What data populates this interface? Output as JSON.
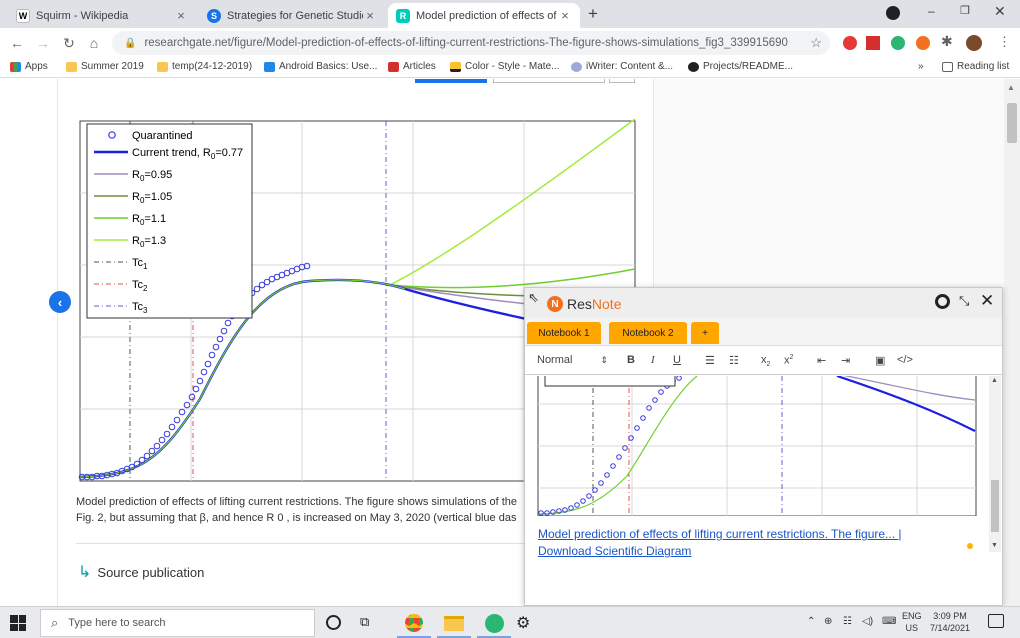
{
  "tabs": [
    {
      "title": "Squirm - Wikipedia",
      "favicon": "W"
    },
    {
      "title": "Strategies for Genetic Studies of",
      "favicon": "S"
    },
    {
      "title": "Model prediction of effects of lift",
      "favicon": "R"
    }
  ],
  "address": "researchgate.net/figure/Model-prediction-of-effects-of-lifting-current-restrictions-The-figure-shows-simulations_fig3_339915690",
  "bookmarks": [
    "Apps",
    "Summer 2019",
    "temp(24-12-2019)",
    "Android Basics: Use...",
    "Articles",
    "Color - Style - Mate...",
    "iWriter: Content &...",
    "Projects/README...",
    "Reading list"
  ],
  "legend": {
    "quarantined": "Quarantined",
    "current": "Current trend, R",
    "current_sub": "0",
    "current_val": "=0.77",
    "r095": "=0.95",
    "r105": "=1.05",
    "r11": "=1.1",
    "r13": "=1.3",
    "r_letter": "R",
    "r_sub": "0",
    "tc_letter": "Tc",
    "tc1": "1",
    "tc2": "2",
    "tc3": "3"
  },
  "caption": {
    "line1": "Model prediction of effects of lifting current restrictions. The figure shows simulations of the",
    "line2": "Fig. 2, but assuming that β, and hence R 0 , is increased on May 3, 2020 (vertical blue das"
  },
  "source_publication": "Source publication",
  "resnote": {
    "brand_res": "Res",
    "brand_note": "Note",
    "notebook_tabs": [
      "Notebook 1",
      "Notebook 2",
      "+"
    ],
    "format_select": "Normal",
    "link_text": "Model prediction of effects of lifting current restrictions. The figure... | Download Scientific Diagram",
    "link_sep": "|"
  },
  "taskbar": {
    "search_placeholder": "Type here to search",
    "lang": "ENG",
    "region": "US",
    "time": "3:09 PM",
    "date": "7/14/2021"
  },
  "colors": {
    "blue_curve": "#1f1fe0",
    "purple": "#a08cbe",
    "olive": "#6b8e3a",
    "green": "#6fcf2f",
    "lightgreen": "#a6ea3a",
    "tc_red": "#e05050",
    "tc_blue": "#6060d0",
    "accent_orange": "#ffa600"
  }
}
